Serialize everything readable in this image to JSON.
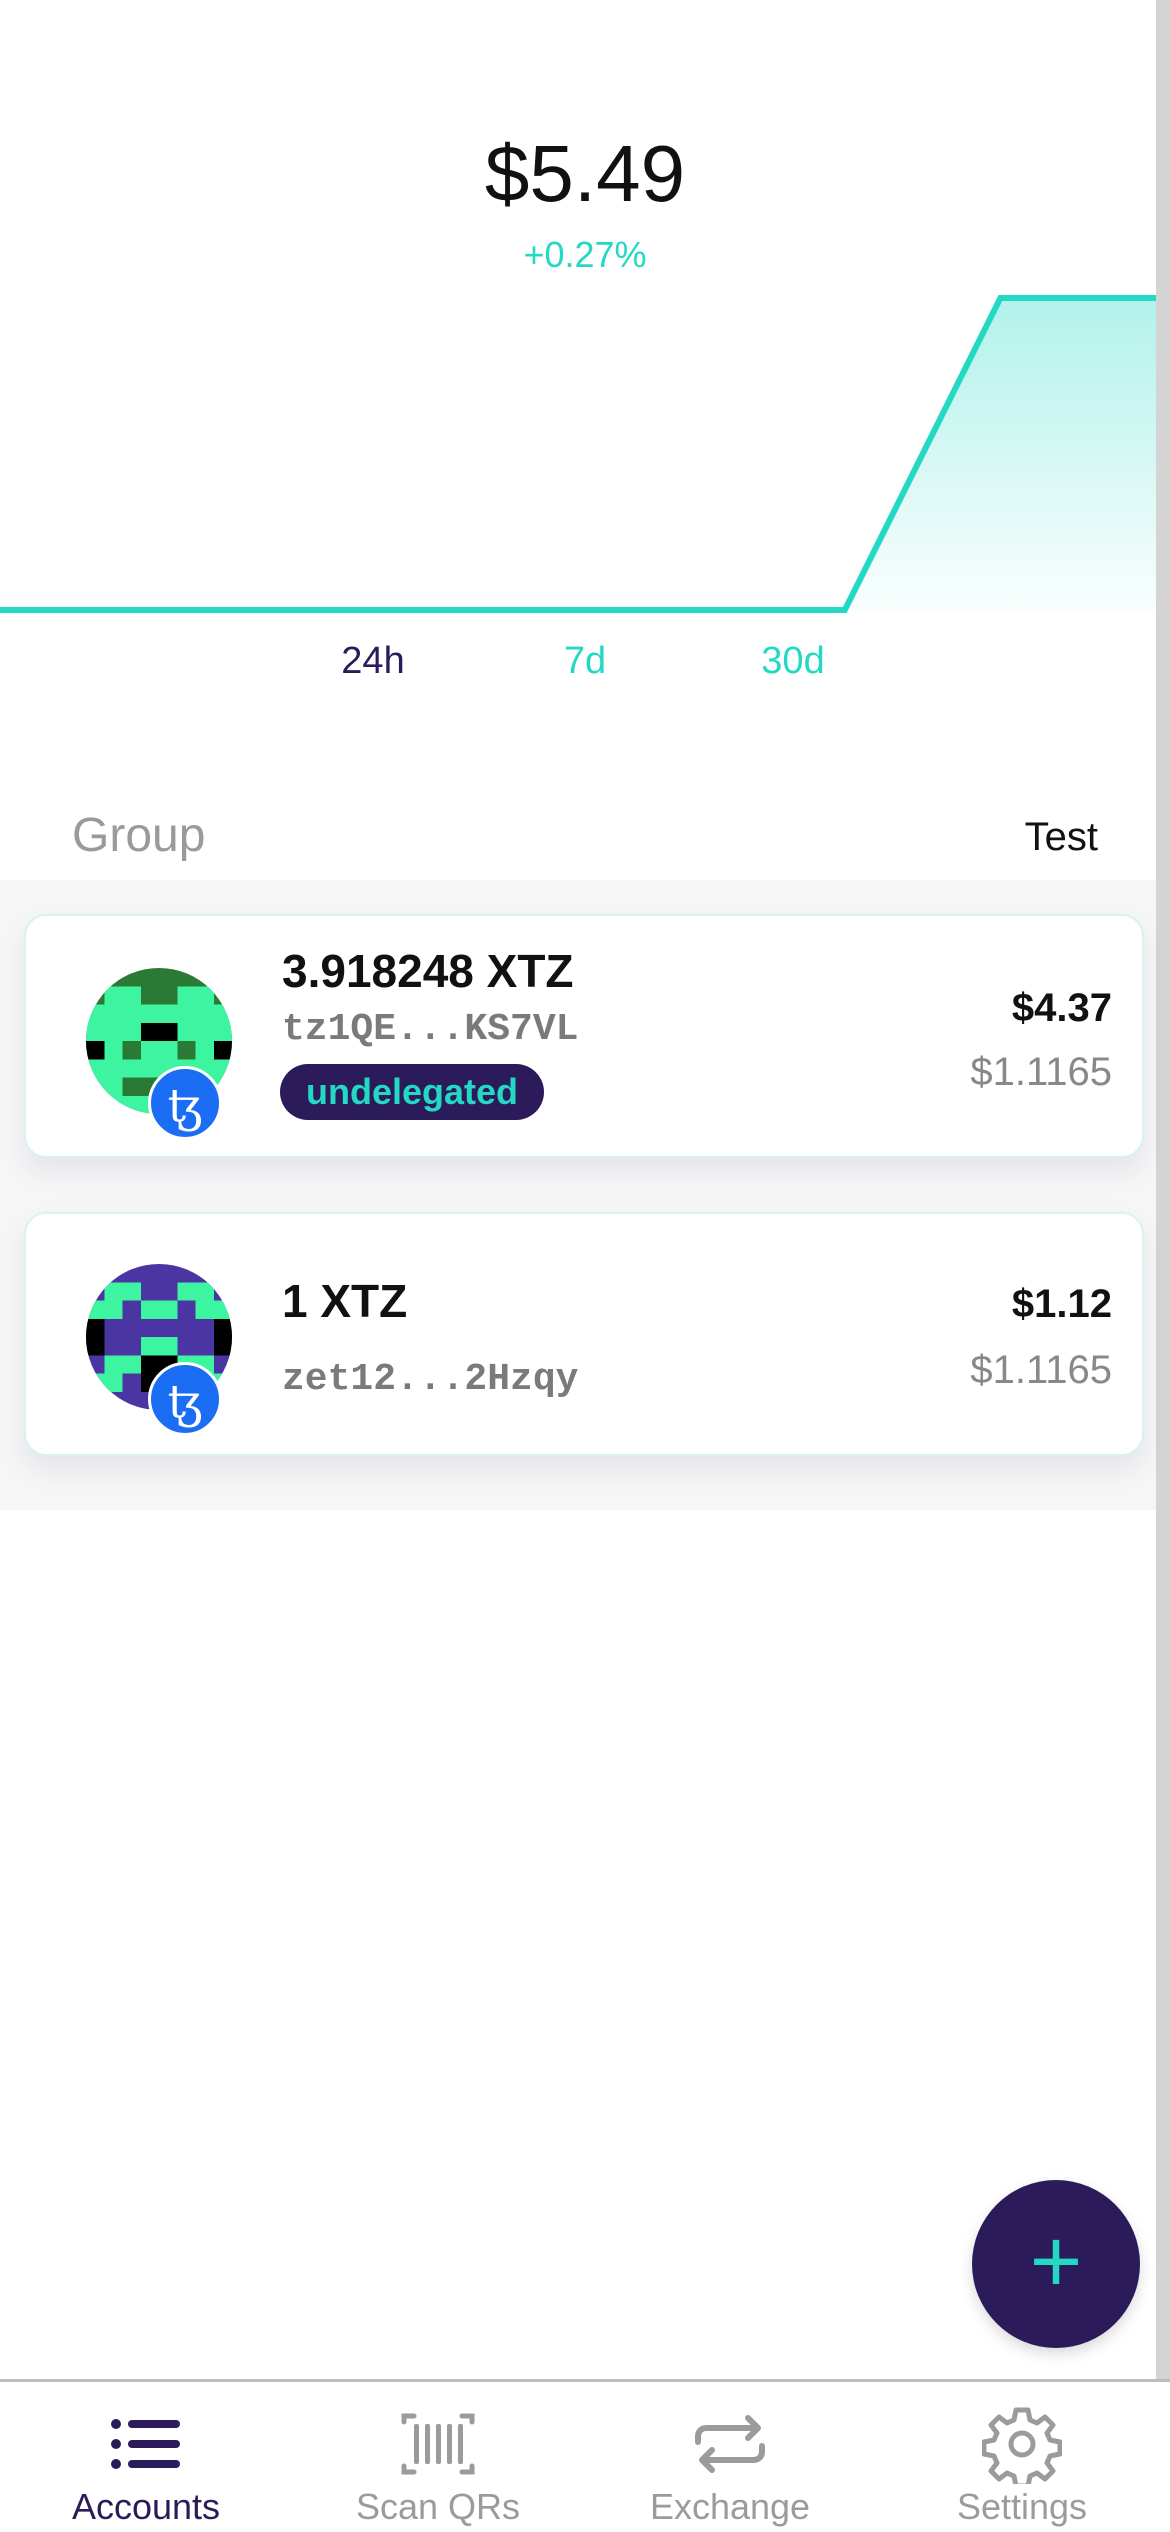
{
  "portfolio": {
    "balance": "$5.49",
    "change": "+0.27%"
  },
  "chart_data": {
    "type": "area",
    "note_series": "portfolio value over time",
    "x": [
      0,
      1,
      2,
      3,
      4,
      5,
      6,
      7,
      8,
      9,
      10
    ],
    "y": [
      0,
      0,
      0,
      0,
      0,
      0,
      0,
      0,
      0,
      1,
      1
    ],
    "color": "#23d9c4"
  },
  "ranges": [
    {
      "label": "24h",
      "active": true
    },
    {
      "label": "7d",
      "active": false
    },
    {
      "label": "30d",
      "active": false
    }
  ],
  "group": {
    "label": "Group",
    "value": "Test"
  },
  "accounts": [
    {
      "amount": "3.918248 XTZ",
      "address": "tz1QE...KS7VL",
      "badge": "undelegated",
      "usd": "$4.37",
      "rate": "$1.1165",
      "badge_icon": "tezos-icon"
    },
    {
      "amount": "1 XTZ",
      "address": "zet12...2Hzqy",
      "usd": "$1.12",
      "rate": "$1.1165",
      "badge_icon": "tezos-icon"
    }
  ],
  "tezos_glyph": "ꜩ",
  "fab": {
    "symbol": "+"
  },
  "tabs": [
    {
      "label": "Accounts",
      "icon": "list-icon",
      "active": true
    },
    {
      "label": "Scan QRs",
      "icon": "barcode-icon",
      "active": false
    },
    {
      "label": "Exchange",
      "icon": "exchange-icon",
      "active": false
    },
    {
      "label": "Settings",
      "icon": "gear-icon",
      "active": false
    }
  ],
  "colors": {
    "accent": "#23d9c4",
    "primary": "#2b1b5a",
    "tezos_blue": "#1b6ef3",
    "inactive_tab": "#9b9b9b"
  }
}
